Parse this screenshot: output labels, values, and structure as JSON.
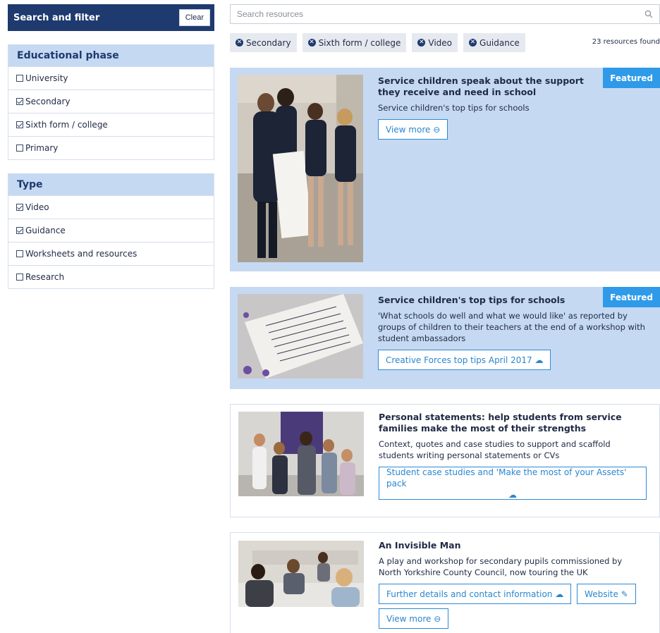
{
  "sidebar": {
    "title": "Search and filter",
    "clear_label": "Clear",
    "groups": [
      {
        "title": "Educational phase",
        "options": [
          {
            "label": "University",
            "checked": false
          },
          {
            "label": "Secondary",
            "checked": true
          },
          {
            "label": "Sixth form / college",
            "checked": true
          },
          {
            "label": "Primary",
            "checked": false
          }
        ]
      },
      {
        "title": "Type",
        "options": [
          {
            "label": "Video",
            "checked": true
          },
          {
            "label": "Guidance",
            "checked": true
          },
          {
            "label": "Worksheets and resources",
            "checked": false
          },
          {
            "label": "Research",
            "checked": false
          }
        ]
      }
    ]
  },
  "search": {
    "placeholder": "Search resources",
    "icon": "search-icon"
  },
  "chips": [
    "Secondary",
    "Sixth form / college",
    "Video",
    "Guidance"
  ],
  "results_count": "23 resources found",
  "cards": [
    {
      "featured": true,
      "badge": "Featured",
      "title": "Service children speak about the support they receive and need in school",
      "description": "Service children's top tips for schools",
      "buttons": [
        {
          "label": "View more",
          "icon": "arrow-circle-icon"
        }
      ]
    },
    {
      "featured": true,
      "badge": "Featured",
      "title": "Service children's top tips for schools",
      "description": "'What schools do well and what we would like' as reported by groups of children to their teachers at the end of a workshop with student ambassadors",
      "buttons": [
        {
          "label": "Creative Forces top tips April 2017",
          "icon": "cloud-download-icon"
        }
      ]
    },
    {
      "featured": false,
      "title": "Personal statements: help students from service families make the most of their strengths",
      "description": "Context, quotes and case studies to support and scaffold students writing personal statements or CVs",
      "buttons": [
        {
          "label": "Student case studies and 'Make the most of your Assets' pack",
          "icon": "cloud-download-icon"
        }
      ]
    },
    {
      "featured": false,
      "title": "An Invisible Man",
      "description": "A play and workshop for secondary pupils commissioned by North Yorkshire County Council, now touring the UK",
      "buttons": [
        {
          "label": "Further details and contact information",
          "icon": "cloud-download-icon"
        },
        {
          "label": "Website",
          "icon": "link-icon"
        },
        {
          "label": "View more",
          "icon": "arrow-circle-icon"
        }
      ]
    }
  ],
  "colors": {
    "navy": "#1e3a6e",
    "featured_bg": "#c6d9f2",
    "accent_blue": "#2f9be8",
    "button_text": "#2a86cf"
  }
}
